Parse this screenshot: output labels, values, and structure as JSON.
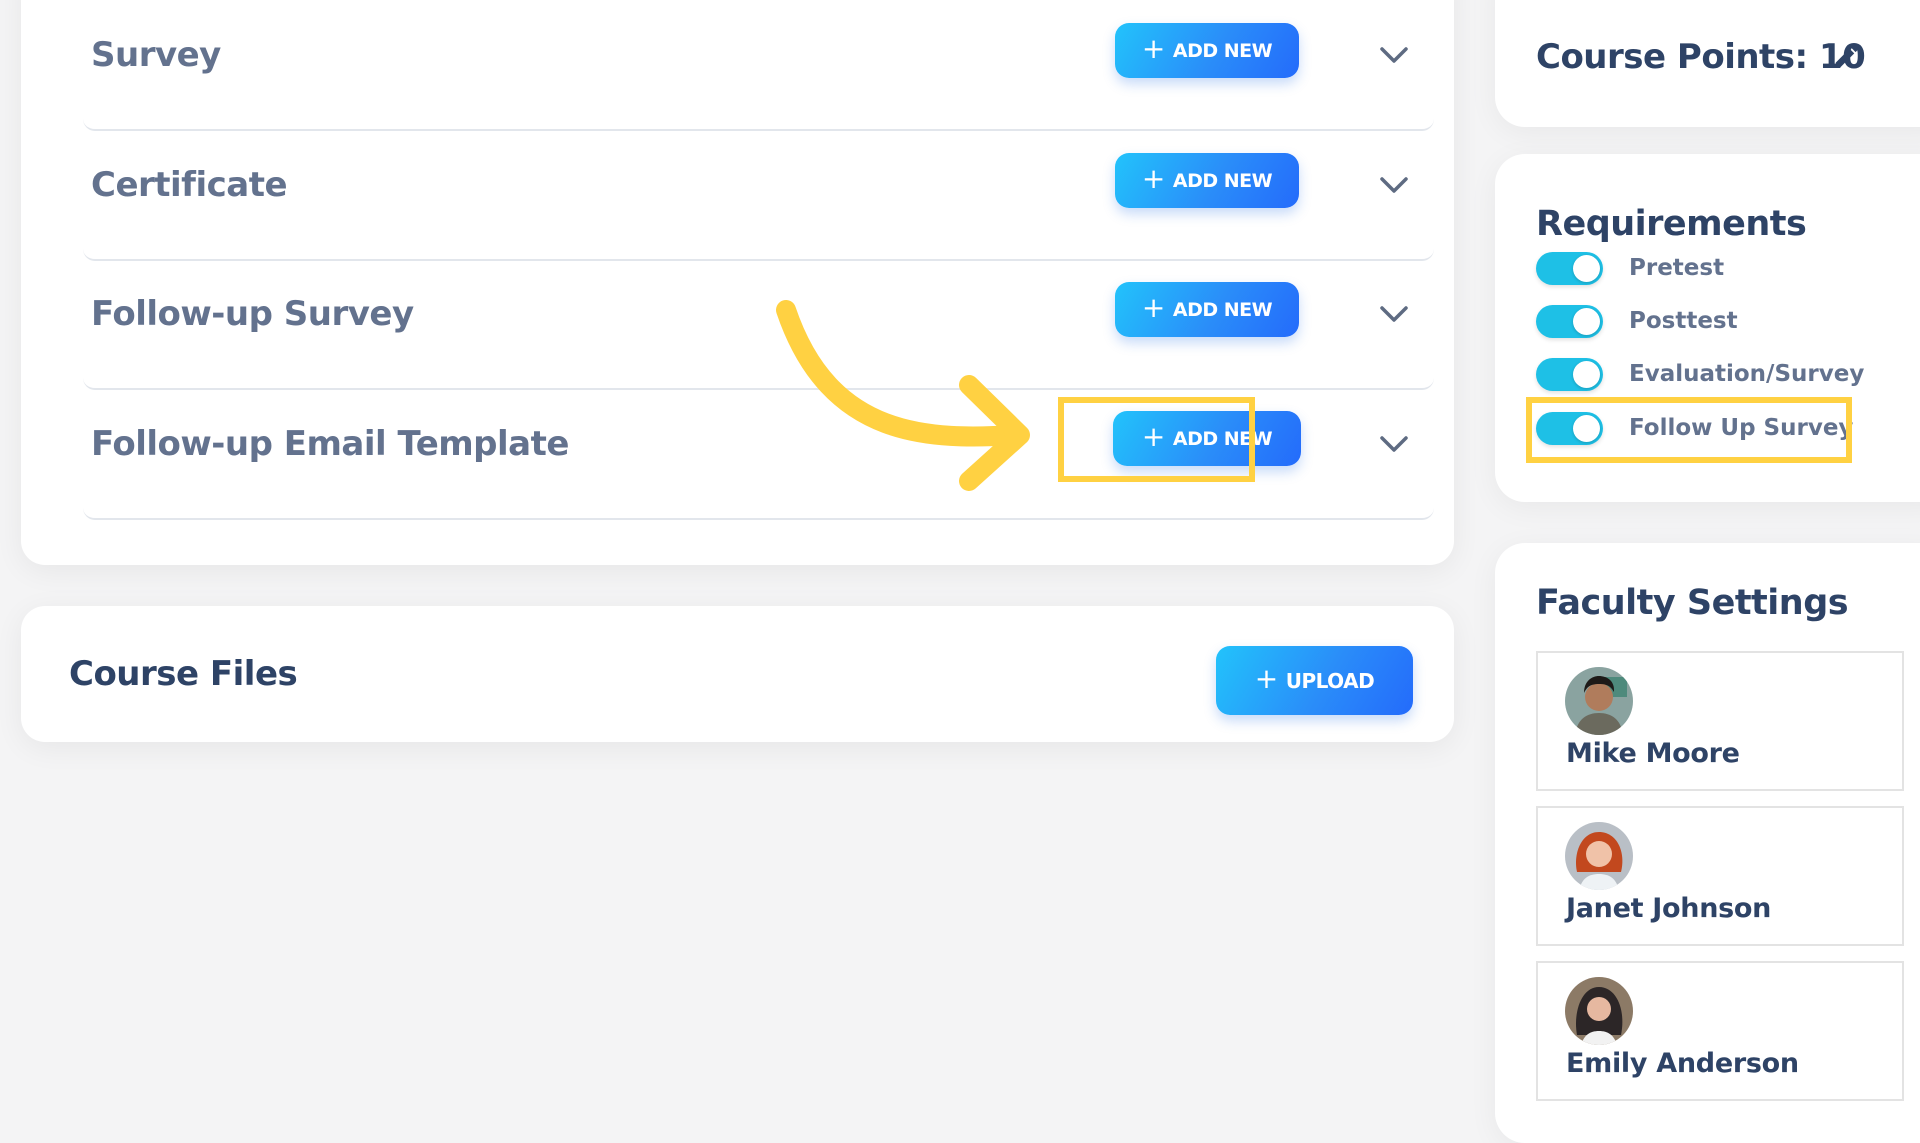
{
  "sections": [
    {
      "title": "Survey",
      "button": "ADD NEW"
    },
    {
      "title": "Certificate",
      "button": "ADD NEW"
    },
    {
      "title": "Follow-up Survey",
      "button": "ADD NEW"
    },
    {
      "title": "Follow-up Email Template",
      "button": "ADD NEW"
    }
  ],
  "course_files": {
    "title": "Course Files",
    "button": "UPLOAD"
  },
  "course_points": {
    "label": "Course Points: 10"
  },
  "requirements": {
    "title": "Requirements",
    "items": [
      {
        "label": "Pretest",
        "enabled": true
      },
      {
        "label": "Posttest",
        "enabled": true
      },
      {
        "label": "Evaluation/Survey",
        "enabled": true
      },
      {
        "label": "Follow Up Survey",
        "enabled": true
      }
    ]
  },
  "faculty": {
    "title": "Faculty Settings",
    "members": [
      {
        "name": "Mike Moore"
      },
      {
        "name": "Janet Johnson"
      },
      {
        "name": "Emily Anderson"
      }
    ]
  },
  "colors": {
    "accent_start": "#22c3fb",
    "accent_end": "#246bfb",
    "toggle_on": "#1ec0e6",
    "highlight": "#ffd142",
    "heading": "#2e4366",
    "subheading": "#63728e"
  }
}
